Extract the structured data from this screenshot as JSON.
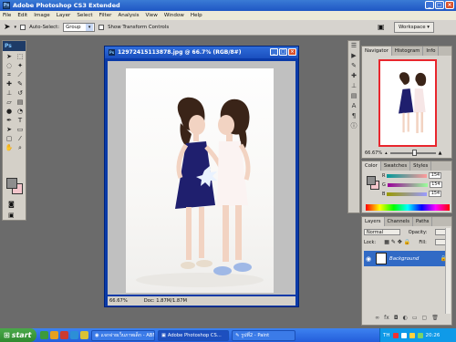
{
  "app": {
    "title": "Adobe Photoshop CS3 Extended",
    "logo": "Ps"
  },
  "menu": [
    "File",
    "Edit",
    "Image",
    "Layer",
    "Select",
    "Filter",
    "Analysis",
    "View",
    "Window",
    "Help"
  ],
  "options": {
    "auto_select_label": "Auto-Select:",
    "auto_select_value": "Group",
    "show_transform_label": "Show Transform Controls",
    "workspace_label": "Workspace ▾"
  },
  "document": {
    "title": "12972415113878.jpg @ 66.7% (RGB/8#)",
    "zoom": "66.67%",
    "doc_size": "Doc: 1.87M/1.87M"
  },
  "navigator": {
    "tabs": [
      "Navigator",
      "Histogram",
      "Info"
    ],
    "zoom": "66.67%",
    "zoom_level_fraction": 0.55
  },
  "color": {
    "tabs": [
      "Color",
      "Swatches",
      "Styles"
    ],
    "channels": [
      {
        "label": "R",
        "value": "154"
      },
      {
        "label": "G",
        "value": "154"
      },
      {
        "label": "B",
        "value": "154"
      }
    ],
    "foreground": "#9a9a9a",
    "background": "#f3c5cb"
  },
  "layers": {
    "tabs": [
      "Layers",
      "Channels",
      "Paths"
    ],
    "blend_mode": "Normal",
    "opacity_label": "Opacity:",
    "lock_label": "Lock:",
    "fill_label": "Fill:",
    "layer_name": "Background"
  },
  "taskbar": {
    "start_label": "start",
    "tasks": [
      "แจกจ่ายเว็บภาพเด็ก - ABN...",
      "Adobe Photoshop CS...",
      "รูปที่2 - Paint"
    ],
    "tray_lang": "TH",
    "clock": "20:26"
  },
  "accent": "#316ac5"
}
